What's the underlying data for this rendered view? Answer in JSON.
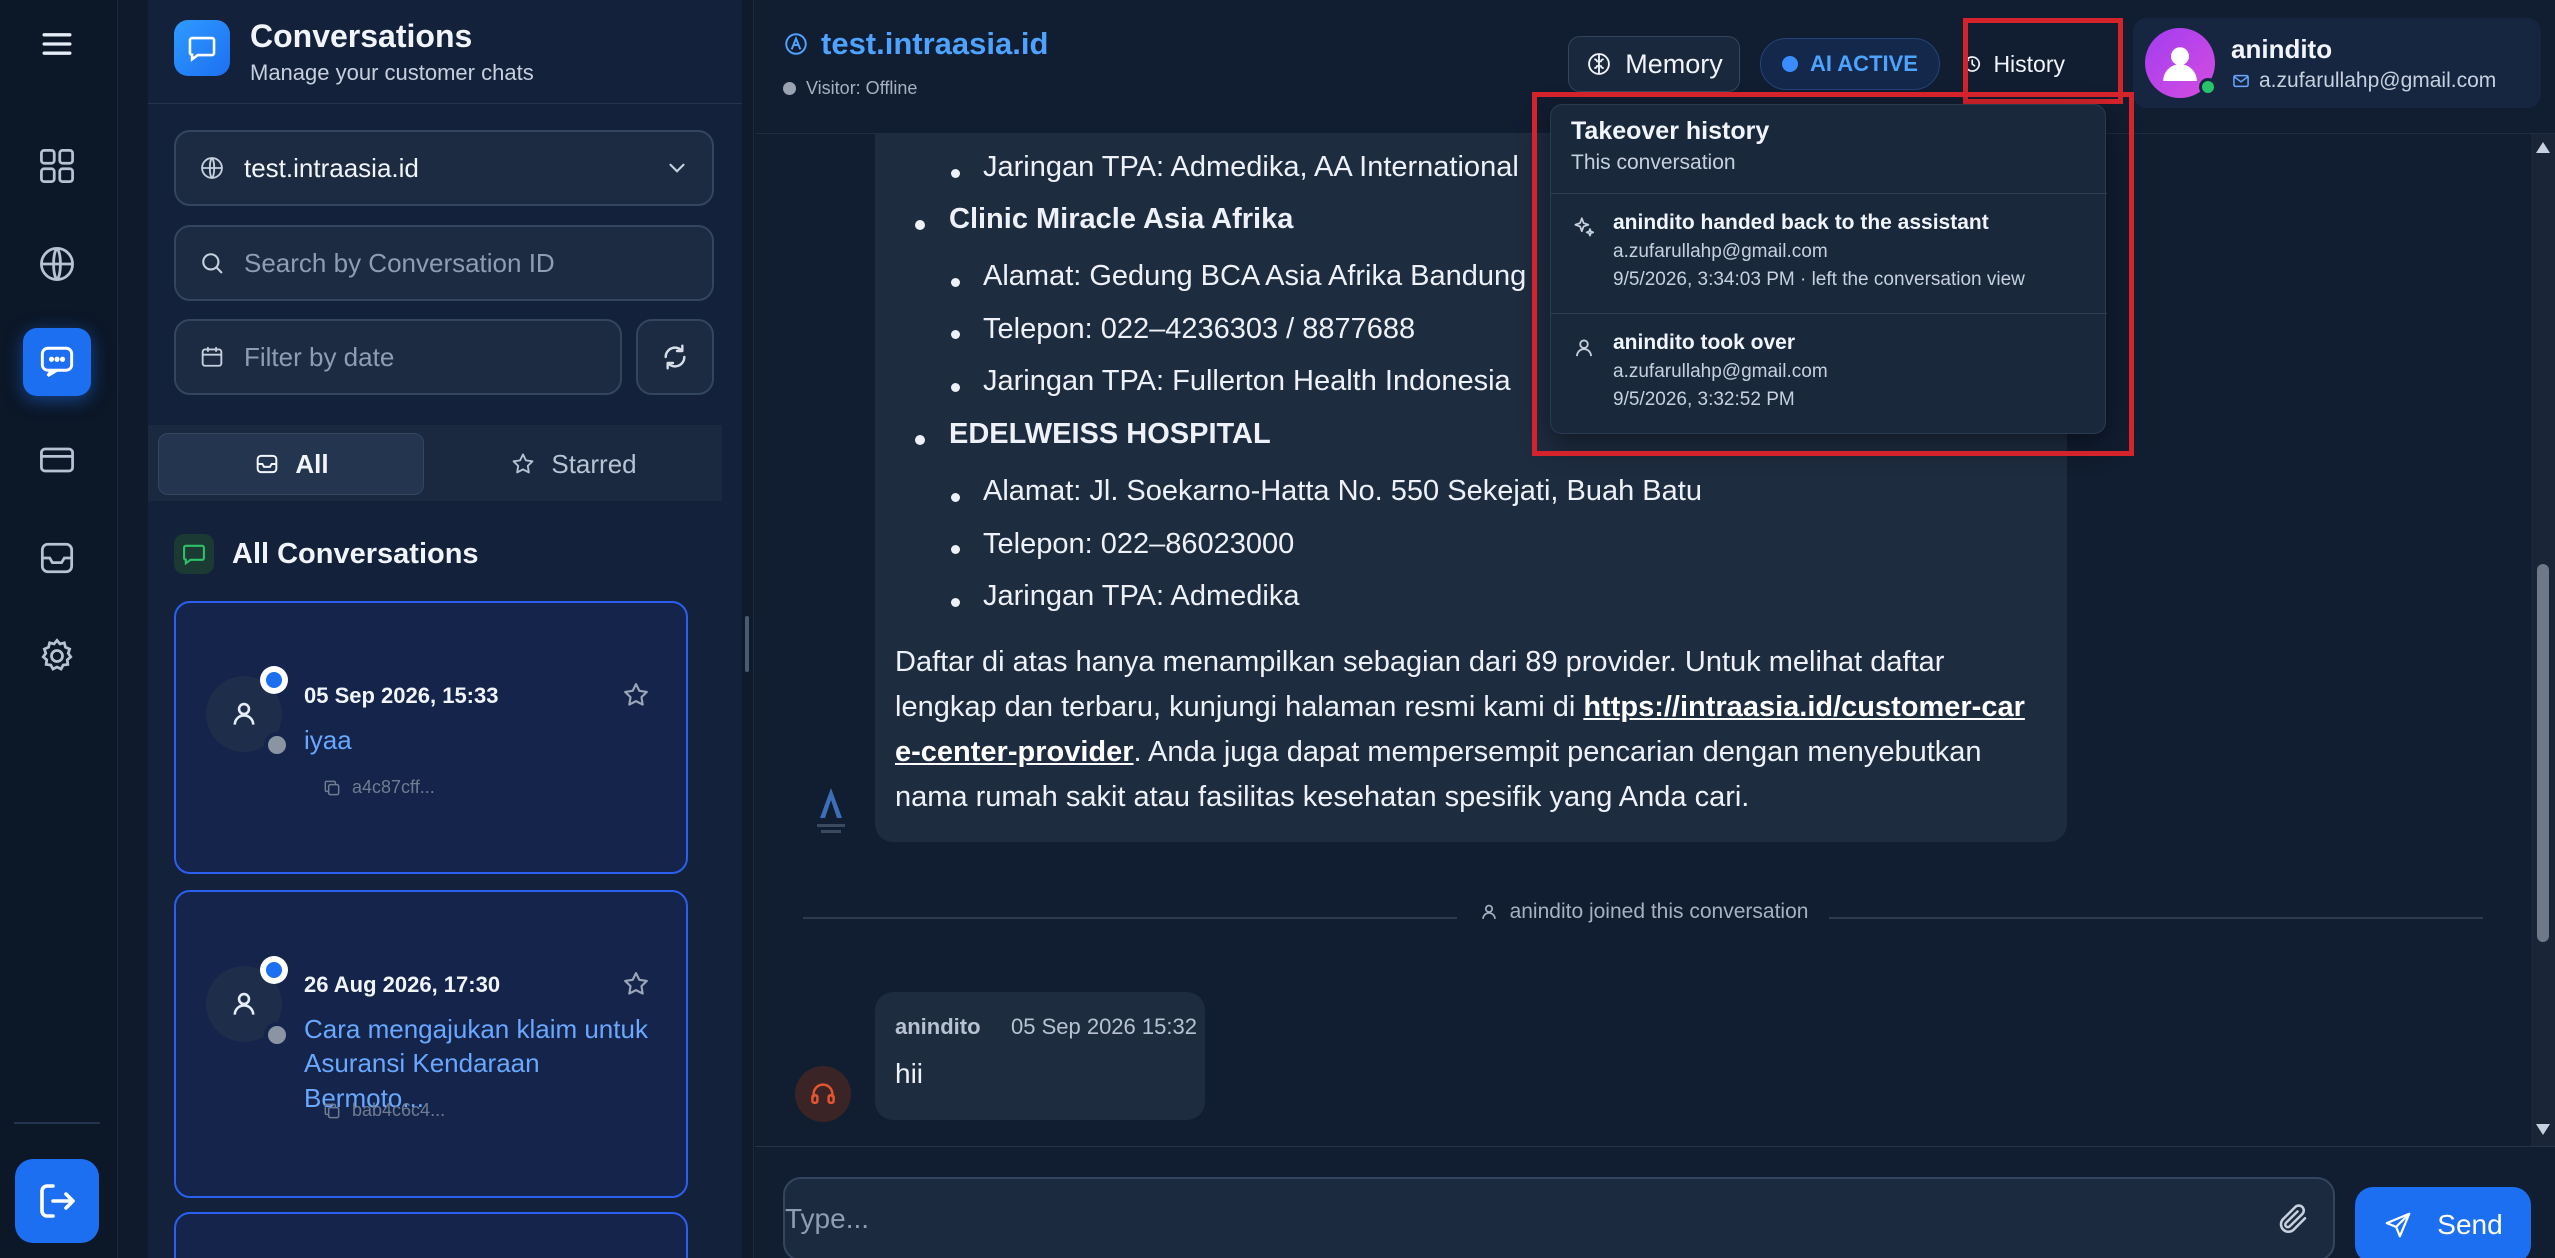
{
  "rail": {
    "items": [
      {
        "name": "menu-icon"
      },
      {
        "name": "dashboard-icon"
      },
      {
        "name": "globe-icon"
      },
      {
        "name": "chat-icon",
        "active": true
      },
      {
        "name": "billing-card-icon"
      },
      {
        "name": "inbox-icon"
      },
      {
        "name": "settings-gear-icon"
      },
      {
        "name": "logout-icon"
      }
    ]
  },
  "conversations": {
    "title": "Conversations",
    "subtitle": "Manage your customer chats",
    "site_select": "test.intraasia.id",
    "search_placeholder": "Search by Conversation ID",
    "date_placeholder": "Filter by date",
    "tabs": {
      "all": "All",
      "starred": "Starred"
    },
    "section_title": "All Conversations",
    "items": [
      {
        "date": "05 Sep 2026, 15:33",
        "preview": "iyaa",
        "id": "a4c87cff..."
      },
      {
        "date": "26 Aug 2026, 17:30",
        "preview_line1": "Cara mengajukan klaim untuk",
        "preview_line2": "Asuransi Kendaraan Bermoto...",
        "id": "bab4c6c4..."
      }
    ]
  },
  "chat": {
    "site": "test.intraasia.id",
    "visitor_status": "Visitor: Offline",
    "memory_label": "Memory",
    "ai_status": "AI ACTIVE",
    "history_label": "History",
    "user": {
      "name": "anindito",
      "email": "a.zufarullahp@gmail.com"
    },
    "bot_message": {
      "l1": "Jaringan TPA: Admedika, AA International",
      "l2": "Clinic Miracle Asia Afrika",
      "l3": "Alamat: Gedung BCA Asia Afrika Bandung",
      "l4": "Telepon: 022–4236303 / 8877688",
      "l5": "Jaringan TPA: Fullerton Health Indonesia",
      "l6": "EDELWEISS HOSPITAL",
      "l7": "Alamat: Jl. Soekarno-Hatta No. 550 Sekejati, Buah Batu",
      "l8": "Telepon: 022–86023000",
      "l9": "Jaringan TPA: Admedika",
      "p1": "Daftar di atas hanya menampilkan sebagian dari 89 provider. Untuk melihat daftar lengkap dan terbaru, kunjungi halaman resmi kami di ",
      "link_a": "https://intraasia.id/customer-car",
      "link_b": "e-center-provider",
      "p2": ". Anda juga dapat mempersempit pencarian dengan menyebutkan nama rumah sakit atau fasilitas kesehatan spesifik yang Anda cari."
    },
    "system_note": "anindito joined this conversation",
    "agent_message": {
      "name": "anindito",
      "time": "05 Sep 2026   15:32",
      "text": "hii"
    },
    "composer_placeholder": "Type...",
    "send_label": "Send"
  },
  "history_dropdown": {
    "title": "Takeover history",
    "subtitle": "This conversation",
    "items": [
      {
        "title": "anindito handed back to the assistant",
        "email": "a.zufarullahp@gmail.com",
        "time": "9/5/2026, 3:34:03 PM · left the conversation view"
      },
      {
        "title": "anindito took over",
        "email": "a.zufarullahp@gmail.com",
        "time": "9/5/2026, 3:32:52 PM"
      }
    ]
  },
  "colors": {
    "accent": "#1d6ff2",
    "link": "#4da3ff",
    "highlight": "#d5232b",
    "online": "#27c46b"
  }
}
